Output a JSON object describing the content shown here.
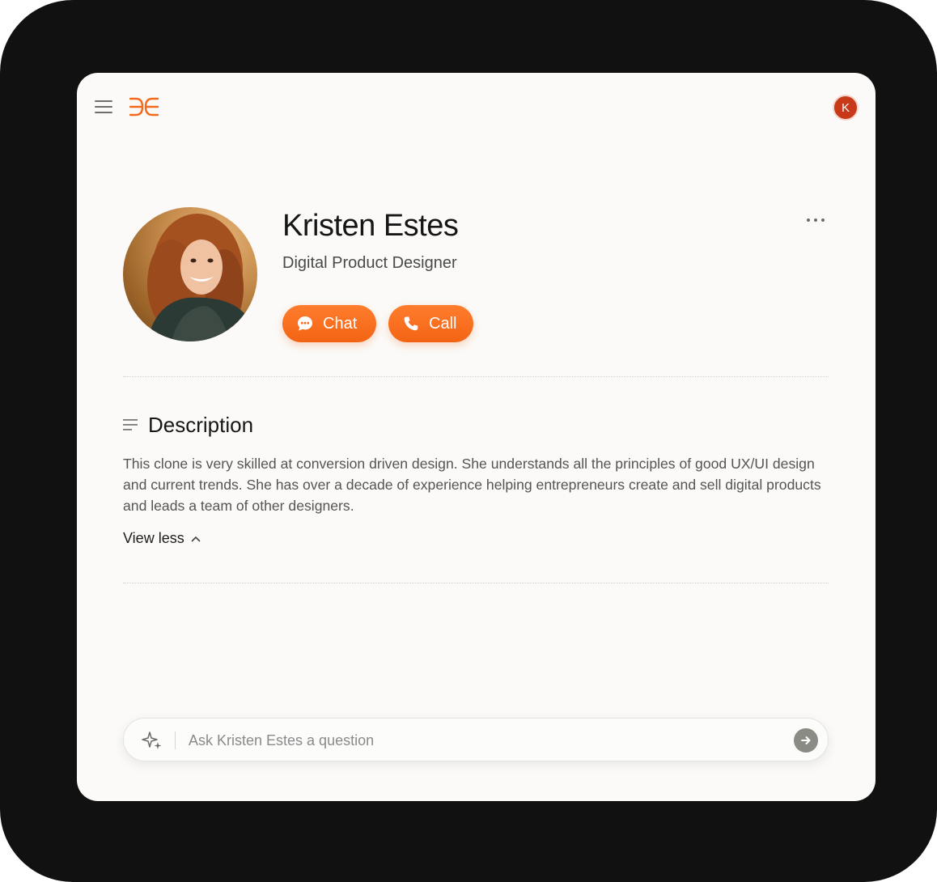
{
  "header": {
    "user_initial": "K"
  },
  "profile": {
    "name": "Kristen Estes",
    "role": "Digital Product Designer",
    "chat_label": "Chat",
    "call_label": "Call"
  },
  "description": {
    "title": "Description",
    "body": "This clone is very skilled at conversion driven design. She understands all the principles of good UX/UI design and current trends. She has over a decade of experience helping entrepreneurs create and sell digital products and leads a team of other designers.",
    "toggle_label": "View less"
  },
  "ask": {
    "placeholder": "Ask Kristen Estes a question"
  },
  "icons": {
    "menu": "menu-icon",
    "logo": "brand-logo",
    "more": "more-icon",
    "chat": "chat-bubble-icon",
    "call": "phone-icon",
    "description": "text-lines-icon",
    "toggle": "chevron-up-icon",
    "sparkle": "sparkle-icon",
    "send": "arrow-right-icon"
  },
  "colors": {
    "accent": "#f26b1d",
    "avatar_bg": "#c8391a",
    "background": "#fbfaf8",
    "frame": "#111111"
  }
}
